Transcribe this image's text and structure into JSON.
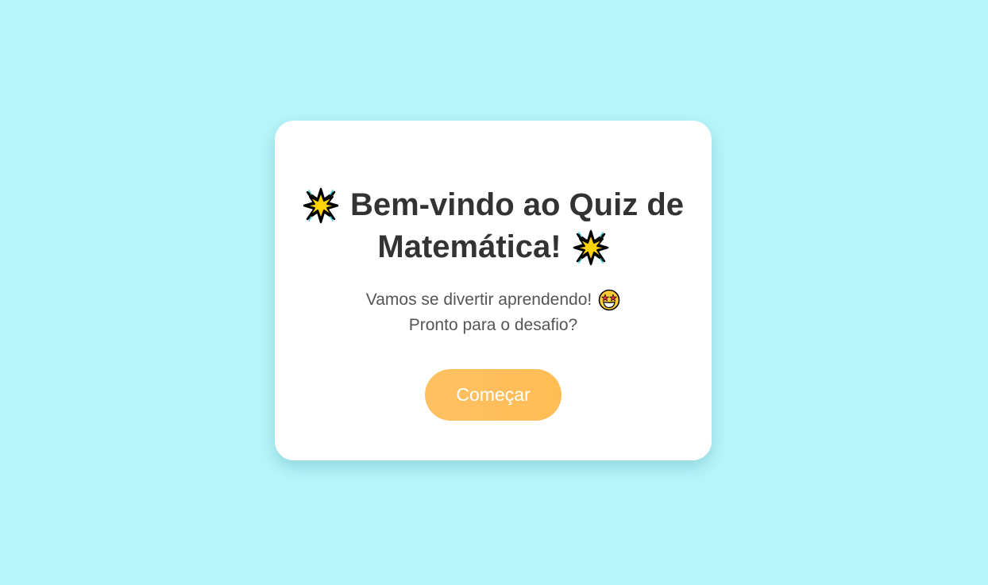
{
  "page": {
    "background_color": "#b8f6fc"
  },
  "welcome_card": {
    "title_line_1": "Bem-vindo ao Quiz de",
    "title_line_2": "Matemática!",
    "title_icon": "glowing-star-icon",
    "subtitle_line_1": "Vamos se divertir aprendendo!",
    "subtitle_icon": "star-struck-face-icon",
    "subtitle_line_2": "Pronto para o desafio?",
    "start_button_label": "Começar",
    "button_color": "#ffbd55",
    "title_color": "#333333"
  }
}
